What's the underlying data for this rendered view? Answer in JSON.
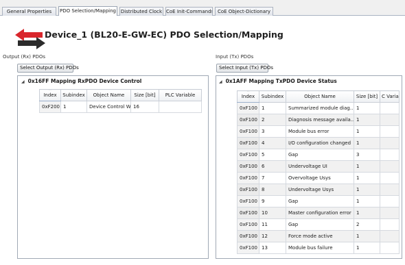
{
  "tabs": [
    {
      "label": "General Properties",
      "active": false
    },
    {
      "label": "PDO Selection/Mapping",
      "active": true
    },
    {
      "label": "Distributed Clock",
      "active": false
    },
    {
      "label": "CoE Init-Commands",
      "active": false
    },
    {
      "label": "CoE Object-Dictionary",
      "active": false
    }
  ],
  "header": {
    "title": "Device_1 (BL20-E-GW-EC) PDO Selection/Mapping",
    "logo_icon": "pdo-mapping-arrows-icon",
    "logo_colors": {
      "red": "#d9262c",
      "dark": "#2b2b2b"
    }
  },
  "output_panel": {
    "label": "Output (Rx) PDOs",
    "select_button": "Select Output (Rx) PDOs",
    "mapping_title": "0x16FF Mapping RxPDO Device Control",
    "columns": [
      "Index",
      "Subindex",
      "Object Name",
      "Size [bit]",
      "PLC Variable"
    ],
    "rows": [
      [
        "0xF200",
        "1",
        "Device Control W...",
        "16",
        ""
      ]
    ]
  },
  "input_panel": {
    "label": "Input (Tx) PDOs",
    "select_button": "Select Input (Tx) PDOs",
    "mapping_title": "0x1AFF Mapping TxPDO Device Status",
    "columns": [
      "Index",
      "Subindex",
      "Object Name",
      "Size [bit]",
      "C Varia"
    ],
    "rows": [
      [
        "0xF100",
        "1",
        "Summarized module diag...",
        "1",
        ""
      ],
      [
        "0xF100",
        "2",
        "Diagnosis message availa...",
        "1",
        ""
      ],
      [
        "0xF100",
        "3",
        "Module bus error",
        "1",
        ""
      ],
      [
        "0xF100",
        "4",
        "I/O configuration changed",
        "1",
        ""
      ],
      [
        "0xF100",
        "5",
        "Gap",
        "3",
        ""
      ],
      [
        "0xF100",
        "6",
        "Undervoltage UI",
        "1",
        ""
      ],
      [
        "0xF100",
        "7",
        "Overvoltage Usys",
        "1",
        ""
      ],
      [
        "0xF100",
        "8",
        "Undervoltage Usys",
        "1",
        ""
      ],
      [
        "0xF100",
        "9",
        "Gap",
        "1",
        ""
      ],
      [
        "0xF100",
        "10",
        "Master configuration error",
        "1",
        ""
      ],
      [
        "0xF100",
        "11",
        "Gap",
        "2",
        ""
      ],
      [
        "0xF100",
        "12",
        "Force mode active",
        "1",
        ""
      ],
      [
        "0xF100",
        "13",
        "Module bus failure",
        "1",
        ""
      ]
    ]
  },
  "colors": {
    "tab_border": "#aab2bf",
    "panel_border": "#9fa8b4",
    "alt_row": "#f1f1f1"
  }
}
